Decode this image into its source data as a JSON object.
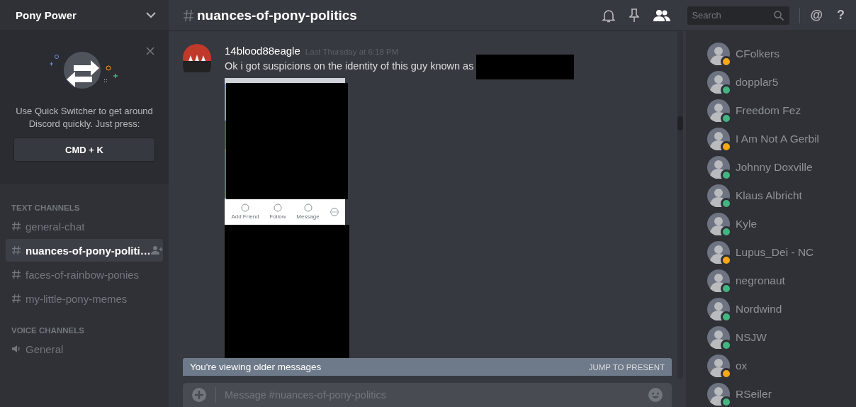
{
  "server": {
    "name": "Pony Power"
  },
  "quick_switcher": {
    "text": "Use Quick Switcher to get around Discord quickly. Just press:",
    "shortcut": "CMD + K"
  },
  "channel_groups": [
    {
      "title": "TEXT CHANNELS",
      "channels": [
        {
          "name": "general-chat",
          "kind": "text",
          "selected": false
        },
        {
          "name": "nuances-of-pony-politi…",
          "kind": "text",
          "selected": true
        },
        {
          "name": "faces-of-rainbow-ponies",
          "kind": "text",
          "selected": false
        },
        {
          "name": "my-little-pony-memes",
          "kind": "text",
          "selected": false
        }
      ]
    },
    {
      "title": "VOICE CHANNELS",
      "channels": [
        {
          "name": "General",
          "kind": "voice",
          "selected": false
        }
      ]
    }
  ],
  "header": {
    "title": "nuances-of-pony-politics",
    "search": {
      "placeholder": "Search"
    },
    "mention": "@",
    "help": "?"
  },
  "message": {
    "author": "14blood88eagle",
    "time": "Last Thursday at 6:18 PM",
    "text": "Ok i got suspicions on the identity of this guy known as",
    "attachment": {
      "actions": [
        "Add Friend",
        "Follow",
        "Message"
      ]
    }
  },
  "banner": {
    "text": "You're viewing older messages",
    "action": "JUMP TO PRESENT"
  },
  "composer": {
    "placeholder": "Message #nuances-of-pony-politics"
  },
  "members": [
    {
      "name": "CFolkers",
      "color": "#faa61a"
    },
    {
      "name": "dopplar5",
      "color": "#43b581"
    },
    {
      "name": "Freedom Fez",
      "color": "#43b581"
    },
    {
      "name": "I Am Not A Gerbil",
      "color": "#faa61a"
    },
    {
      "name": "Johnny Doxville",
      "color": "#43b581"
    },
    {
      "name": "Klaus Albricht",
      "color": "#43b581"
    },
    {
      "name": "Kyle",
      "color": "#43b581"
    },
    {
      "name": "Lupus_Dei - NC",
      "color": "#faa61a"
    },
    {
      "name": "negronaut",
      "color": "#43b581"
    },
    {
      "name": "Nordwind",
      "color": "#43b581"
    },
    {
      "name": "NSJW",
      "color": "#43b581"
    },
    {
      "name": "ox",
      "color": "#faa61a"
    },
    {
      "name": "RSeiler",
      "color": "#43b581"
    }
  ]
}
